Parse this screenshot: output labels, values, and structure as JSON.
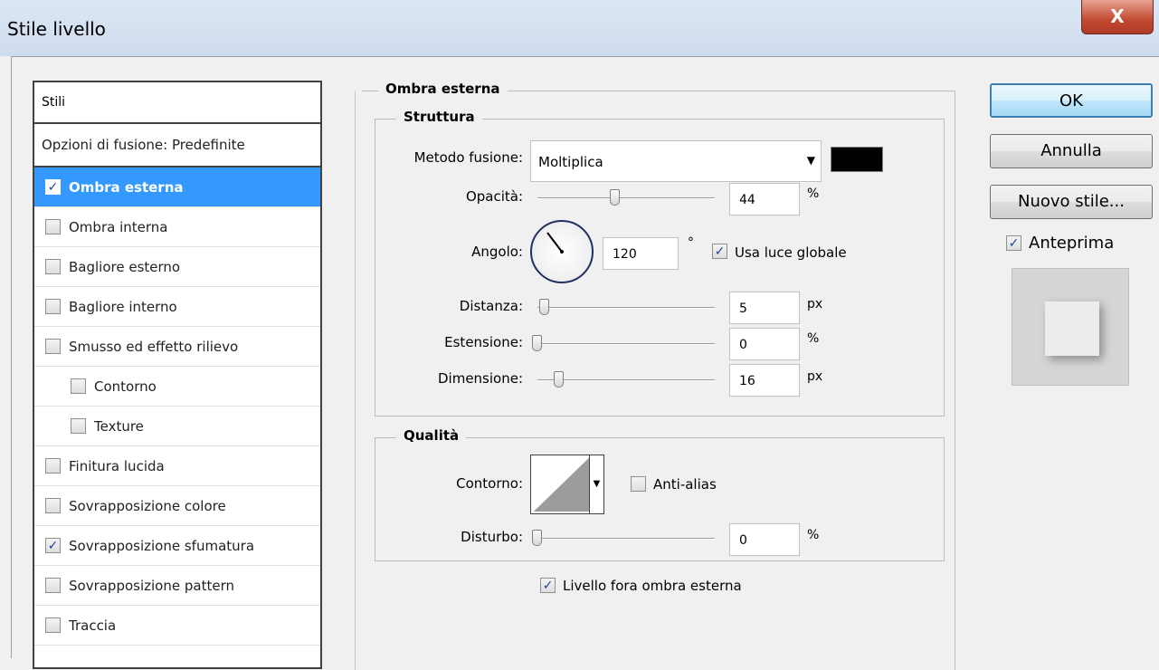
{
  "window": {
    "title": "Stile livello",
    "close_label": "X"
  },
  "styles_panel": {
    "header": "Stili",
    "blend_options": "Opzioni di fusione: Predefinite",
    "items": [
      {
        "label": "Ombra esterna",
        "checked": true
      },
      {
        "label": "Ombra interna",
        "checked": false
      },
      {
        "label": "Bagliore esterno",
        "checked": false
      },
      {
        "label": "Bagliore interno",
        "checked": false
      },
      {
        "label": "Smusso ed effetto rilievo",
        "checked": false
      },
      {
        "label": "Contorno",
        "checked": false
      },
      {
        "label": "Texture",
        "checked": false
      },
      {
        "label": "Finitura lucida",
        "checked": false
      },
      {
        "label": "Sovrapposizione colore",
        "checked": false
      },
      {
        "label": "Sovrapposizione sfumatura",
        "checked": true
      },
      {
        "label": "Sovrapposizione pattern",
        "checked": false
      },
      {
        "label": "Traccia",
        "checked": false
      }
    ]
  },
  "drop_shadow": {
    "section_title": "Ombra esterna",
    "structure": {
      "title": "Struttura",
      "blend_mode_label": "Metodo fusione:",
      "blend_mode_value": "Moltiplica",
      "color": "#000000",
      "opacity_label": "Opacità:",
      "opacity_value": "44",
      "opacity_unit": "%",
      "opacity_level": 0.44,
      "angle_label": "Angolo:",
      "angle_value": "120",
      "angle_unit": "°",
      "global_light_label": "Usa luce globale",
      "global_light_checked": true,
      "distance_label": "Distanza:",
      "distance_value": "5",
      "distance_unit": "px",
      "spread_label": "Estensione:",
      "spread_value": "0",
      "spread_unit": "%",
      "size_label": "Dimensione:",
      "size_value": "16",
      "size_unit": "px"
    },
    "quality": {
      "title": "Qualità",
      "contour_label": "Contorno:",
      "anti_alias_label": "Anti-alias",
      "anti_alias_checked": false,
      "noise_label": "Disturbo:",
      "noise_value": "0",
      "noise_unit": "%"
    },
    "knockout_label": "Livello fora ombra esterna",
    "knockout_checked": true
  },
  "buttons": {
    "ok": "OK",
    "cancel": "Annulla",
    "new_style": "Nuovo stile..."
  },
  "preview": {
    "label": "Anteprima",
    "checked": true
  }
}
